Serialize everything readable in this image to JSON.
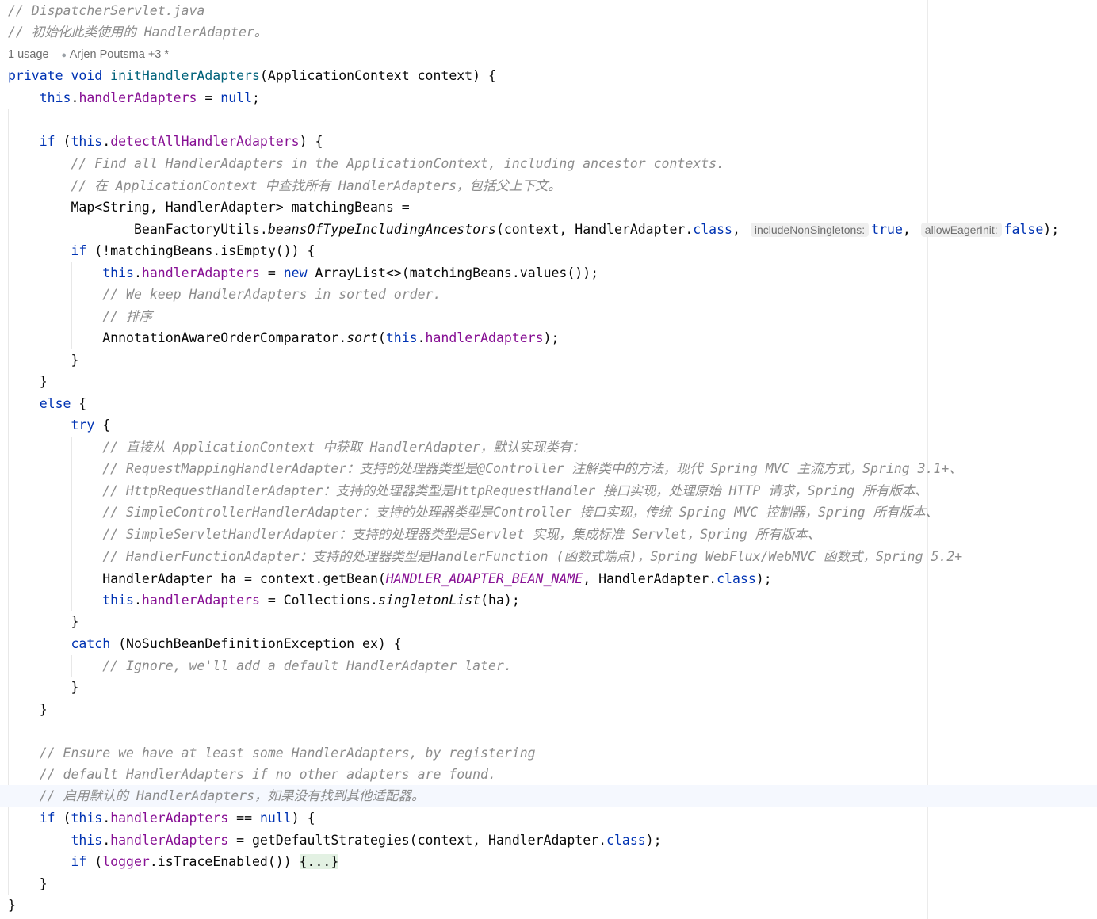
{
  "editor": {
    "header_comments": [
      "// DispatcherServlet.java",
      "// 初始化此类使用的 HandlerAdapter。"
    ],
    "inlay": {
      "usage": "1 usage",
      "author_icon": "person-icon",
      "author": "Arjen Poutsma +3 *"
    },
    "code": {
      "sig_kw": "private void",
      "sig_name": "initHandlerAdapters",
      "sig_rest": "(ApplicationContext context) {",
      "this": "this",
      "field_handlerAdapters": "handlerAdapters",
      "field_detectAll": "detectAllHandlerAdapters",
      "field_logger": "logger",
      "kw_null": "null",
      "kw_if": "if",
      "kw_else": "else",
      "kw_try": "try",
      "kw_catch": "catch",
      "kw_new": "new",
      "kw_class": "class",
      "kw_true": "true",
      "kw_false": "false",
      "comment_find_all": "// Find all HandlerAdapters in the ApplicationContext, including ancestor contexts.",
      "comment_find_all_cn": "// 在 ApplicationContext 中查找所有 HandlerAdapters，包括父上下文。",
      "map_decl": "Map<String, HandlerAdapter> matchingBeans =",
      "bfu": "BeanFactoryUtils.",
      "bfu_method": "beansOfTypeIncludingAncestors",
      "bfu_args": "(context, HandlerAdapter.",
      "hint_include": "includeNonSingletons:",
      "hint_eager": "allowEagerInit:",
      "if_not_empty": "(!matchingBeans.isEmpty()) {",
      "arraylist": "ArrayList<>(matchingBeans.values());",
      "comment_sorted": "// We keep HandlerAdapters in sorted order.",
      "comment_sorted_cn": "// 排序",
      "aaoc": "AnnotationAwareOrderComparator.",
      "sort": "sort",
      "comment_direct": "// 直接从 ApplicationContext 中获取 HandlerAdapter，默认实现类有：",
      "comment_rmha": "// RequestMappingHandlerAdapter：支持的处理器类型是@Controller 注解类中的方法，现代 Spring MVC 主流方式，Spring 3.1+、",
      "comment_hrha": "// HttpRequestHandlerAdapter：支持的处理器类型是HttpRequestHandler 接口实现，处理原始 HTTP 请求，Spring 所有版本、",
      "comment_scha": "// SimpleControllerHandlerAdapter：支持的处理器类型是Controller 接口实现，传统 Spring MVC 控制器，Spring 所有版本、",
      "comment_ssha": "// SimpleServletHandlerAdapter：支持的处理器类型是Servlet 实现，集成标准 Servlet，Spring 所有版本、",
      "comment_hfa": "// HandlerFunctionAdapter：支持的处理器类型是HandlerFunction (函数式端点)，Spring WebFlux/WebMVC 函数式，Spring 5.2+",
      "getbean_start": "HandlerAdapter ha = context.getBean(",
      "bean_name_const": "HANDLER_ADAPTER_BEAN_NAME",
      "getbean_mid": ", HandlerAdapter.",
      "collections": "Collections.",
      "singleton": "singletonList",
      "catch_args": "(NoSuchBeanDefinitionException ex) {",
      "comment_ignore": "// Ignore, we'll add a default HandlerAdapter later.",
      "comment_ensure1": "// Ensure we have at least some HandlerAdapters, by registering",
      "comment_ensure2": "// default HandlerAdapters if no other adapters are found.",
      "comment_ensure_cn": "// 启用默认的 HandlerAdapters，如果没有找到其他适配器。",
      "get_default": "getDefaultStrategies(context, HandlerAdapter.",
      "is_trace": ".isTraceEnabled()) ",
      "folded": "{...}"
    }
  }
}
